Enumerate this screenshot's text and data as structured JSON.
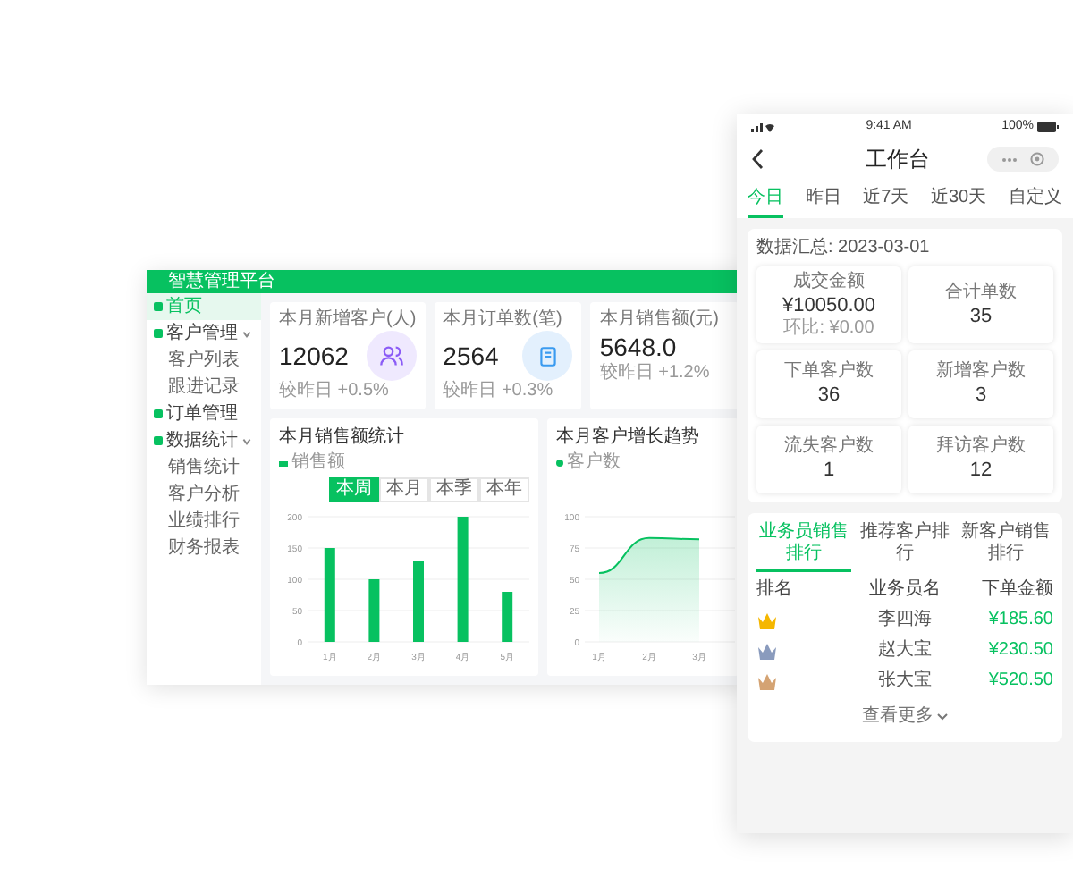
{
  "dashboard": {
    "title": "智慧管理平台",
    "sidebar": [
      {
        "label": "首页",
        "selected": true
      },
      {
        "label": "客户管理",
        "selected": false,
        "expanded": true,
        "children": [
          {
            "label": "客户列表",
            "selected": false
          },
          {
            "label": "跟进记录",
            "selected": false
          }
        ]
      },
      {
        "label": "订单管理",
        "selected": false
      },
      {
        "label": "数据统计",
        "selected": false,
        "expanded": true,
        "children": [
          {
            "label": "销售统计",
            "selected": false
          },
          {
            "label": "客户分析",
            "selected": false
          },
          {
            "label": "业绩排行",
            "selected": false
          },
          {
            "label": "财务报表",
            "selected": false
          }
        ]
      }
    ],
    "stats": [
      {
        "label": "本月新增客户(人)",
        "value": "12062",
        "note": "较昨日 +0.5%"
      },
      {
        "label": "本月订单数(笔)",
        "value": "2564",
        "note": "较昨日 +0.3%"
      },
      {
        "label": "本月销售额(元)",
        "value": "5648.0",
        "note": "较昨日 +1.2%"
      }
    ],
    "bar_panel": {
      "title": "本月销售额统计",
      "ranges": [
        {
          "label": "本周",
          "selected": true
        },
        {
          "label": "本月",
          "selected": false
        },
        {
          "label": "本季",
          "selected": false
        },
        {
          "label": "本年",
          "selected": false
        }
      ],
      "chart_data": {
        "type": "bar",
        "grid": true,
        "categories": [
          "1月",
          "2月",
          "3月",
          "4月",
          "5月"
        ],
        "series": [
          {
            "name": "销售额",
            "color": "#07c160",
            "values": [
              150,
              100,
              130,
              200,
              80
            ]
          }
        ],
        "ylim": [
          0,
          200
        ],
        "yticks": [
          0,
          50,
          100,
          150,
          200
        ]
      }
    },
    "area_panel": {
      "title": "本月客户增长趋势",
      "chart_data": {
        "type": "area",
        "grid": true,
        "x": [
          "1月",
          "2月",
          "3月"
        ],
        "series": [
          {
            "name": "客户数",
            "color": "#07c160",
            "values": [
              55,
              83,
              82
            ]
          }
        ],
        "ylim": [
          0,
          100
        ],
        "yticks": [
          0,
          25,
          50,
          75,
          100
        ]
      }
    }
  },
  "phone": {
    "time": "9:41 AM",
    "battery": "100%",
    "title": "工作台",
    "tabs": [
      {
        "label": "今日",
        "selected": true
      },
      {
        "label": "昨日",
        "selected": false
      },
      {
        "label": "近7天",
        "selected": false
      },
      {
        "label": "近30天",
        "selected": false
      },
      {
        "label": "自定义",
        "selected": false
      }
    ],
    "summary_date": "数据汇总: 2023-03-01",
    "stats": [
      {
        "label": "成交金额",
        "value": "¥10050.00",
        "note": "环比: ¥0.00"
      },
      {
        "label": "合计单数",
        "value": "35"
      },
      {
        "label": "下单客户数",
        "value": "36"
      },
      {
        "label": "新增客户数",
        "value": "3"
      },
      {
        "label": "流失客户数",
        "value": "1"
      },
      {
        "label": "拜访客户数",
        "value": "12"
      }
    ],
    "ranking_tabs": [
      {
        "label": "业务员销售排行",
        "selected": true
      },
      {
        "label": "推荐客户排行",
        "selected": false
      },
      {
        "label": "新客户销售排行",
        "selected": false
      }
    ],
    "columns": [
      "排名",
      "业务员名",
      "下单金额"
    ],
    "rows": [
      {
        "name": "李四海",
        "amount": "¥185.60",
        "color": "#f5b700"
      },
      {
        "name": "赵大宝",
        "amount": "¥230.50",
        "color": "#8a9bbd"
      },
      {
        "name": "张大宝",
        "amount": "¥520.50",
        "color": "#d4a373"
      }
    ],
    "more": "查看更多"
  }
}
